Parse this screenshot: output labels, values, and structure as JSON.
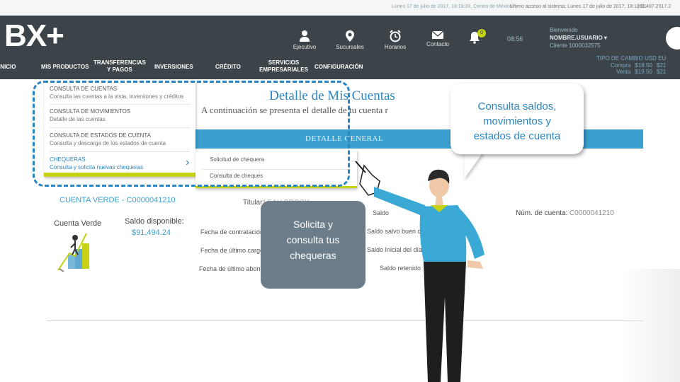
{
  "topbar": {
    "date_info": "Lunes 17 de julio de 2017, 18:18:20, Centro de México",
    "last_access": "Último acceso al sistema: Lunes 17 de julio de 2017, 18:12:31",
    "ip": "(41.407.2017.2"
  },
  "header": {
    "logo": "BX+",
    "icons": [
      {
        "label": "Ejecutivo",
        "icon": "person-icon"
      },
      {
        "label": "Sucursales",
        "icon": "map-pin-icon"
      },
      {
        "label": "Horarios",
        "icon": "alarm-clock-icon"
      },
      {
        "label": "Contacto",
        "icon": "envelope-icon"
      }
    ],
    "notification_count": "0",
    "clock": "08:56",
    "welcome": {
      "greeting": "Bienvenido",
      "user": "NOMBRE.USUARIO ▾",
      "client": "Cliente 1000032575"
    },
    "nav": [
      "INICIO",
      "MIS PRODUCTOS",
      "TRANSFERENCIAS\nY PAGOS",
      "INVERSIONES",
      "CRÉDITO",
      "SERVICIOS\nEMPRESARIALES",
      "CONFIGURACIÓN"
    ],
    "rates": {
      "heading": "TIPO DE CAMBIO   USD   EU",
      "buy_label": "Compra",
      "buy_value": "$18.50",
      "buy_value2": "$21",
      "sell_label": "Venta",
      "sell_value": "$19.50",
      "sell_value2": "$21"
    }
  },
  "dropdown": {
    "items": [
      {
        "title": "CONSULTA DE CUENTAS",
        "desc": "Consulta las cuentas a la vista, inversiones y créditos"
      },
      {
        "title": "CONSULTA DE MOVIMIENTOS",
        "desc": "Detalle de las cuentas"
      },
      {
        "title": "CONSULTA DE ESTADOS DE CUENTA",
        "desc": "Consulta y descarga de los estados de cuenta"
      },
      {
        "title": "CHEQUERAS",
        "desc": "Consulta y solicita nuevas chequeras"
      }
    ],
    "submenu": [
      "Solicitud de chequera",
      "Consulta de cheques"
    ]
  },
  "main": {
    "title": "Detalle de Mis Cuentas",
    "subtitle": "A continuación se presenta el detalle de tu cuenta r",
    "bar_title": "DETALLE GENERAL",
    "account_header": "CUENTA VERDE - C0000041210",
    "account_name": "Cuenta Verde",
    "balance_label": "Saldo disponible:",
    "balance_value": "$91,494.24",
    "titular_label": "Titular:",
    "titular_value": "LEAH BROOK",
    "fields_left": [
      "Fecha de contratación",
      "Fecha de último cargo",
      "Fecha de último abono"
    ],
    "fields_mid": [
      "Saldo",
      "Saldo salvo buen cobro",
      "Saldo Inicial del día",
      "Saldo retenido"
    ],
    "num_cuenta_label": "Núm. de cuenta:",
    "num_cuenta_value": "C0000041210"
  },
  "callouts": {
    "right": "Consulta saldos,\nmovimientos y\nestados de cuenta",
    "left": "Solicita y\nconsulta tus\nchequeras"
  },
  "colors": {
    "accent_blue": "#2a86c2",
    "lime": "#c5d314",
    "header_dark": "#3c4449",
    "bubble_gray": "#6c7d89"
  }
}
